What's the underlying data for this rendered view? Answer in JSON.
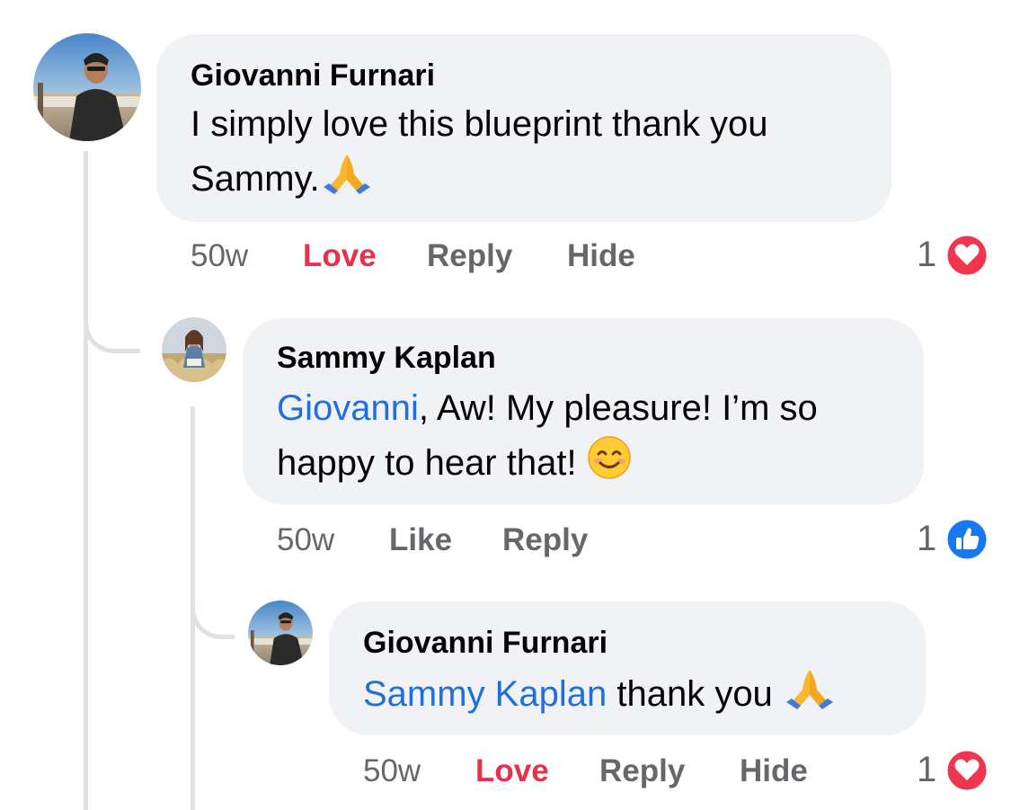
{
  "comments": [
    {
      "author": "Giovanni Furnari",
      "text_line1": "I simply love this blueprint thank you",
      "text_line2": "Sammy.",
      "emoji": "folded-hands",
      "time": "50w",
      "reaction_action": "Love",
      "reply_label": "Reply",
      "hide_label": "Hide",
      "reaction_count": "1",
      "reaction_type": "love"
    },
    {
      "author": "Sammy Kaplan",
      "mention": "Giovanni",
      "text_line1_rest": ", Aw! My pleasure! I’m so",
      "text_line2": "happy to hear that!",
      "emoji": "smiling-face",
      "time": "50w",
      "reaction_action": "Like",
      "reply_label": "Reply",
      "reaction_count": "1",
      "reaction_type": "like"
    },
    {
      "author": "Giovanni Furnari",
      "mention": "Sammy Kaplan",
      "text_rest": " thank you",
      "emoji": "folded-hands",
      "time": "50w",
      "reaction_action": "Love",
      "reply_label": "Reply",
      "hide_label": "Hide",
      "reaction_count": "1",
      "reaction_type": "love"
    }
  ],
  "colors": {
    "bubble": "#f0f2f5",
    "mention": "#216fdb",
    "love": "#e8304a",
    "like": "#1877f2",
    "meta": "#65676b",
    "thread_line": "#dfe1e5"
  }
}
